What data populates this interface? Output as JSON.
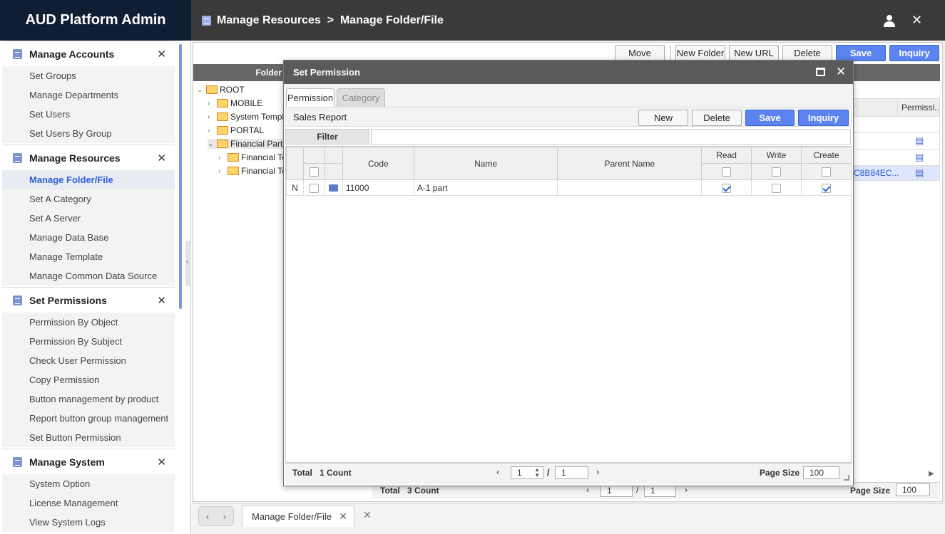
{
  "app": {
    "title": "AUD Platform Admin",
    "breadcrumb": "Manage Resources  >  Manage Folder/File"
  },
  "sidebar": {
    "sections": [
      {
        "title": "Manage Accounts",
        "items": [
          "Set Groups",
          "Manage Departments",
          "Set Users",
          "Set Users By Group"
        ]
      },
      {
        "title": "Manage Resources",
        "items": [
          "Manage Folder/File",
          "Set A Category",
          "Set A Server",
          "Manage Data Base",
          "Manage Template",
          "Manage Common Data Source"
        ]
      },
      {
        "title": "Set Permissions",
        "items": [
          "Permission By Object",
          "Permission By Subject",
          "Check User Permission",
          "Copy Permission",
          "Button management by product",
          "Report button group management",
          "Set Button Permission"
        ]
      },
      {
        "title": "Manage System",
        "items": [
          "System Option",
          "License Management",
          "View System Logs"
        ]
      }
    ],
    "active_item": "Manage Folder/File"
  },
  "toolbar": {
    "move": "Move",
    "new_folder": "New Folder",
    "new_url": "New URL",
    "delete": "Delete",
    "save": "Save",
    "inquiry": "Inquiry"
  },
  "tree": {
    "header": "Folder",
    "items": [
      "ROOT",
      "MOBILE",
      "System Templ",
      "PORTAL",
      "Financial Part",
      "Financial Te",
      "Financial Te"
    ]
  },
  "bg_grid": {
    "col_perm": "Permissi...",
    "cell_id": "C8B84EC..."
  },
  "bg_footer": {
    "total": "Total",
    "count": "3 Count",
    "page": "1",
    "pages": "1",
    "page_size_label": "Page Size",
    "page_size": "100"
  },
  "dialog": {
    "title": "Set Permission",
    "tabs": [
      "Permission",
      "Category"
    ],
    "report_name": "Sales Report",
    "buttons": {
      "new": "New",
      "delete": "Delete",
      "save": "Save",
      "inquiry": "Inquiry"
    },
    "filter_label": "Filter",
    "columns": {
      "code": "Code",
      "name": "Name",
      "parent": "Parent Name",
      "read": "Read",
      "write": "Write",
      "create": "Create"
    },
    "rows": [
      {
        "state": "N",
        "code": "11000",
        "name": "A-1 part",
        "parent": "",
        "read": true,
        "write": false,
        "create": true
      }
    ],
    "footer": {
      "total": "Total",
      "count": "1 Count",
      "page": "1",
      "pages": "1",
      "page_size_label": "Page Size",
      "page_size": "100"
    }
  },
  "bottom_tab": {
    "label": "Manage Folder/File"
  }
}
